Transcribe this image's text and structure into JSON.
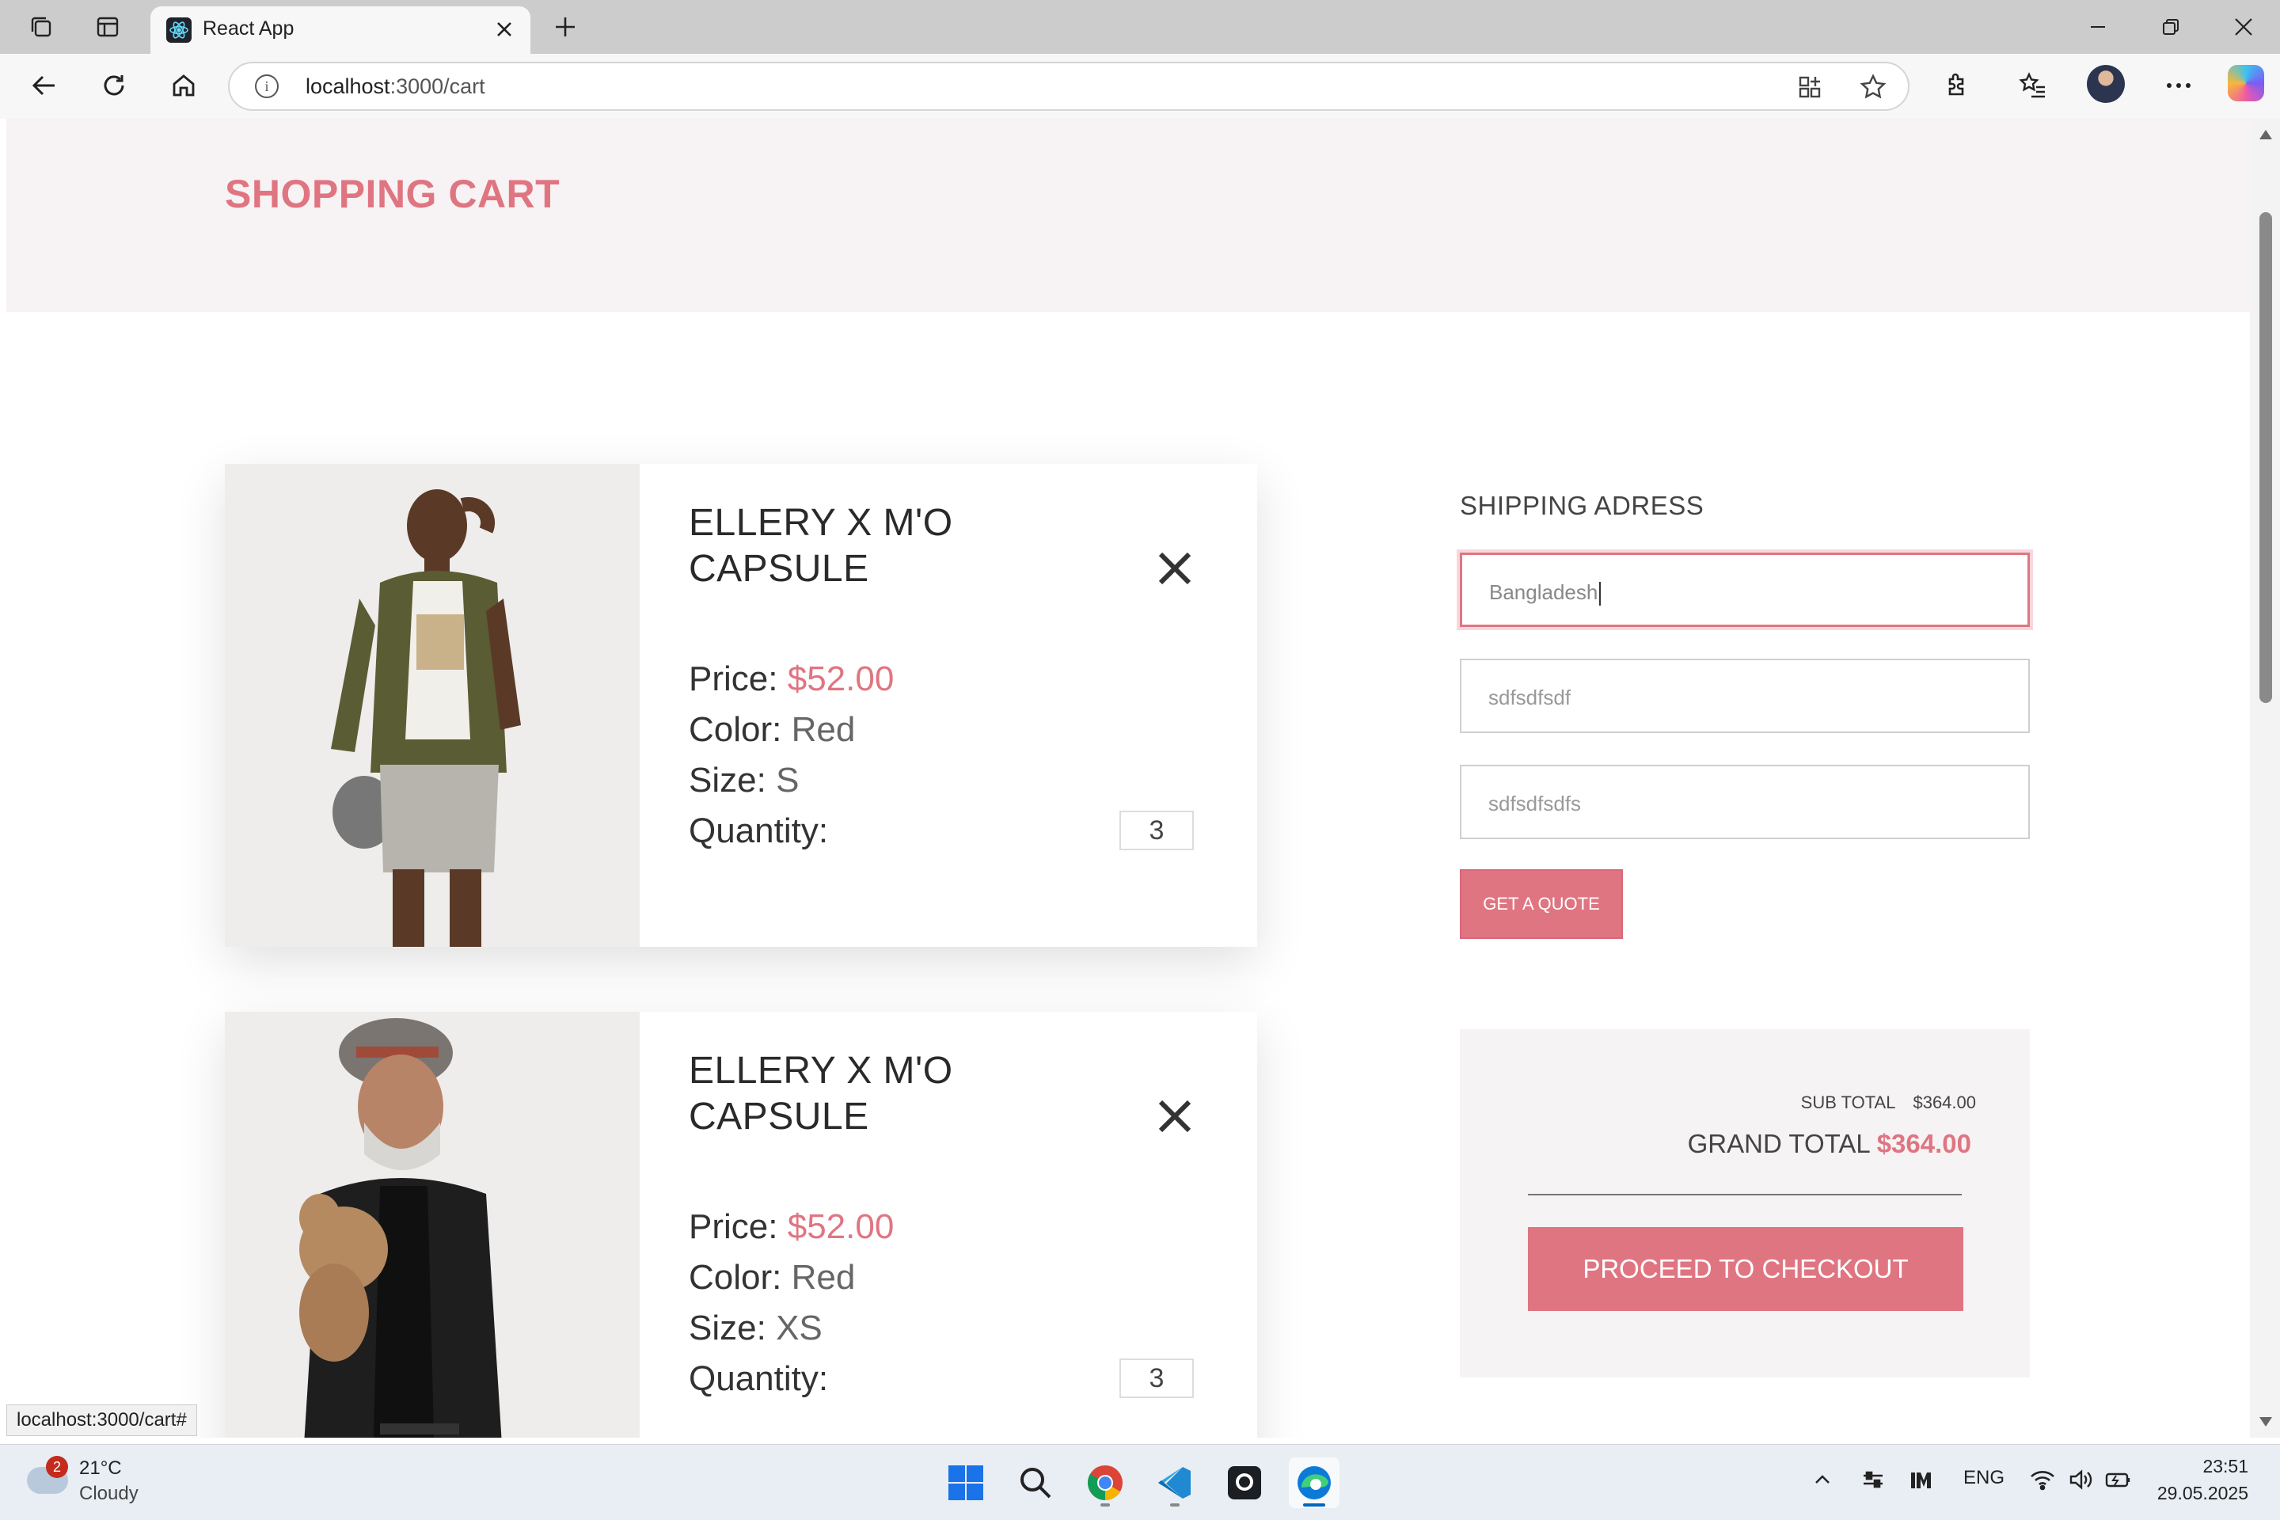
{
  "browser": {
    "tab_title": "React App",
    "url_host": "localhost",
    "url_path": ":3000/cart"
  },
  "page": {
    "title": "SHOPPING CART",
    "cart_items": [
      {
        "name": "ELLERY X M'O CAPSULE",
        "price_label": "Price:",
        "price": "$52.00",
        "color_label": "Color:",
        "color": "Red",
        "size_label": "Size:",
        "size": "S",
        "quantity_label": "Quantity:",
        "quantity": "3"
      },
      {
        "name": "ELLERY X M'O CAPSULE",
        "price_label": "Price:",
        "price": "$52.00",
        "color_label": "Color:",
        "color": "Red",
        "size_label": "Size:",
        "size": "XS",
        "quantity_label": "Quantity:",
        "quantity": "3"
      }
    ],
    "shipping": {
      "title": "SHIPPING ADRESS",
      "fields": [
        "Bangladesh",
        "sdfsdfsdf",
        "sdfsdfsdfs"
      ],
      "quote_button": "GET A QUOTE"
    },
    "totals": {
      "sub_total_label": "SUB TOTAL",
      "sub_total": "$364.00",
      "grand_total_label": "GRAND TOTAL",
      "grand_total": "$364.00",
      "checkout_button": "PROCEED TO CHECKOUT"
    },
    "status_link": "localhost:3000/cart#"
  },
  "taskbar": {
    "weather_badge": "2",
    "temperature": "21°C",
    "weather": "Cloudy",
    "language": "ENG",
    "time": "23:51",
    "date": "29.05.2025"
  },
  "colors": {
    "accent": "#e07582",
    "hero_bg": "#f7f3f4"
  }
}
